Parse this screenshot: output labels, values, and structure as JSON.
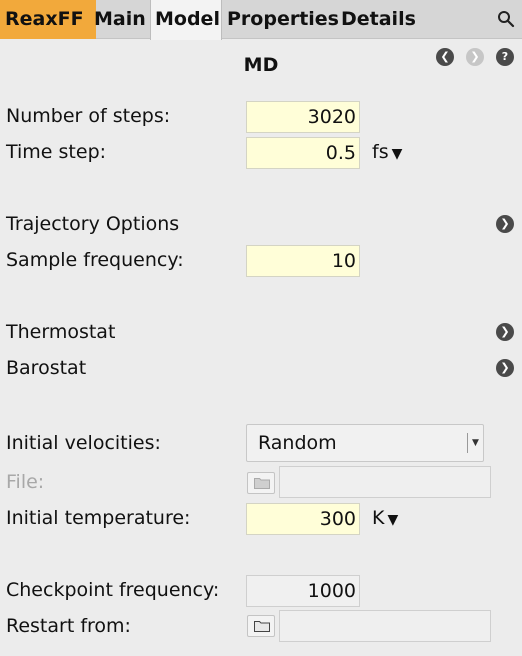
{
  "tabs": {
    "reaxff": "ReaxFF",
    "main": "Main",
    "model": "Model",
    "properties": "Properties",
    "details": "Details"
  },
  "panel": {
    "title": "MD"
  },
  "fields": {
    "steps_label": "Number of steps:",
    "steps_value": "3020",
    "timestep_label": "Time step:",
    "timestep_value": "0.5",
    "timestep_unit": "fs",
    "trajectory_label": "Trajectory Options",
    "sample_label": "Sample frequency:",
    "sample_value": "10",
    "thermostat_label": "Thermostat",
    "barostat_label": "Barostat",
    "velocities_label": "Initial velocities:",
    "velocities_value": "Random",
    "file_label": "File:",
    "file_value": "",
    "temperature_label": "Initial temperature:",
    "temperature_value": "300",
    "temperature_unit": "K",
    "checkpoint_label": "Checkpoint frequency:",
    "checkpoint_value": "1000",
    "restart_label": "Restart from:",
    "restart_value": ""
  },
  "colors": {
    "reaxff_tab": "#f2a93b",
    "input_bg": "#fffed8",
    "tabbar_bg": "#d6d6d6",
    "panel_bg": "#ececec"
  },
  "icons": [
    "search-icon",
    "back-arrow-icon",
    "forward-arrow-icon",
    "help-icon",
    "chevron-right-icon",
    "folder-icon",
    "caret-down-icon"
  ]
}
